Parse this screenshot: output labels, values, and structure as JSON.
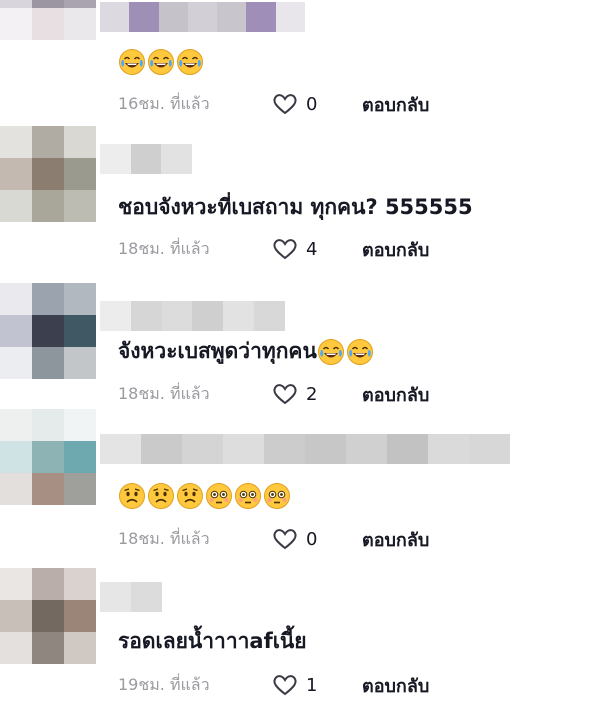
{
  "comments": [
    {
      "text": "",
      "emoji": [
        "sweat-laugh",
        "sweat-laugh",
        "sweat-laugh"
      ],
      "time": "16ชม. ที่แล้ว",
      "likes": "0",
      "reply": "ตอบกลับ",
      "avatar_colors": [
        "#e8e6ea",
        "#b8b2bd",
        "#c9c6cd",
        "#d9d5dc",
        "#9b96a1",
        "#a9a4b0",
        "#f3f1f3",
        "#e7dfe2",
        "#ebe8eb"
      ],
      "name_colors": [
        "#dcd9e0",
        "#9d8fb6",
        "#c5c2ca",
        "#d2cfd6",
        "#c9c5cc",
        "#9f8fb8",
        "#e8e6ea"
      ]
    },
    {
      "text": "ชอบจังหวะที่เบสถาม ทุกคน? 555555",
      "emoji": [],
      "time": "18ชม. ที่แล้ว",
      "likes": "4",
      "reply": "ตอบกลับ",
      "avatar_colors": [
        "#e4e2de",
        "#b0aca3",
        "#dad8d3",
        "#c4b9b0",
        "#8b7d6f",
        "#9b9a8f",
        "#d9d9d4",
        "#a8a79a",
        "#bdbcb2"
      ],
      "name_colors": [
        "#ededed",
        "#cfcfcf",
        "#e2e2e2"
      ]
    },
    {
      "text": "จังหวะเบสพูดว่าทุกคน",
      "emoji": [
        "sweat-laugh",
        "sweat-laugh"
      ],
      "time": "18ชม. ที่แล้ว",
      "likes": "2",
      "reply": "ตอบกลับ",
      "avatar_colors": [
        "#e9e9ee",
        "#9ba3ae",
        "#b1b8c0",
        "#c2c3d0",
        "#3b3f4e",
        "#3f5864",
        "#ecedf0",
        "#8c969c",
        "#c2c6c8"
      ],
      "name_colors": [
        "#ececec",
        "#d6d6d6",
        "#dcdcdc",
        "#cfcfcf",
        "#e2e2e2",
        "#d8d8d8"
      ]
    },
    {
      "text": "",
      "emoji": [
        "worried",
        "worried",
        "worried",
        "flushed",
        "flushed",
        "flushed"
      ],
      "time": "18ชม. ที่แล้ว",
      "likes": "0",
      "reply": "ตอบกลับ",
      "avatar_colors": [
        "#eef0f0",
        "#e5eaeb",
        "#f1f4f4",
        "#cfe3e4",
        "#8eb3b4",
        "#6da9ae",
        "#e2dfdd",
        "#a78f84",
        "#9f9f9c"
      ],
      "name_colors": [
        "#e4e4e4",
        "#cacaca",
        "#d4d4d4",
        "#dddddd",
        "#cccccc",
        "#c7c7c7",
        "#d0d0d0",
        "#c2c2c2",
        "#dadada",
        "#d7d7d7"
      ]
    },
    {
      "text": "รอดเลยน้ำาาาafเนี้ย",
      "emoji": [],
      "time": "19ชม. ที่แล้ว",
      "likes": "1",
      "reply": "ตอบกลับ",
      "avatar_colors": [
        "#eae6e4",
        "#b9aea9",
        "#d9d2cf",
        "#c8bfb9",
        "#736960",
        "#9b8579",
        "#e4e0dd",
        "#8f8680",
        "#cfc8c3"
      ],
      "name_colors": [
        "#e6e6e6",
        "#dcdcdc"
      ]
    }
  ],
  "colors": {
    "text": "#161823",
    "muted": "#9a9aa0"
  }
}
